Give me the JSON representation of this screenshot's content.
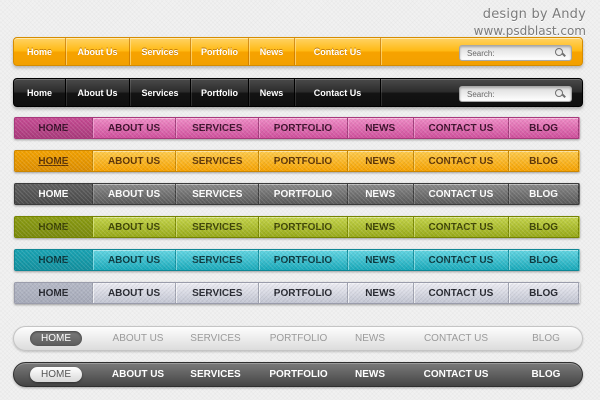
{
  "credit": {
    "line1": "design by Andy",
    "line2": "www.psdblast.com"
  },
  "search": {
    "placeholder": "Search:"
  },
  "nav_short": [
    "Home",
    "About Us",
    "Services",
    "Portfolio",
    "News",
    "Contact Us"
  ],
  "nav_caps": [
    "HOME",
    "ABOUT US",
    "SERVICES",
    "PORTFOLIO",
    "NEWS",
    "CONTACT US",
    "BLOG"
  ],
  "bar_colors": {
    "orange": "#ffb80f",
    "black": "#1a1a1a",
    "pink": "#e06ab1",
    "gold": "#ffbf2a",
    "gray": "#707070",
    "lime": "#b0c232",
    "cyan": "#3fc3d2",
    "silver": "#d9dbe4",
    "light_pill": "#eeeeee",
    "dark_pill": "#5c5c5c"
  }
}
